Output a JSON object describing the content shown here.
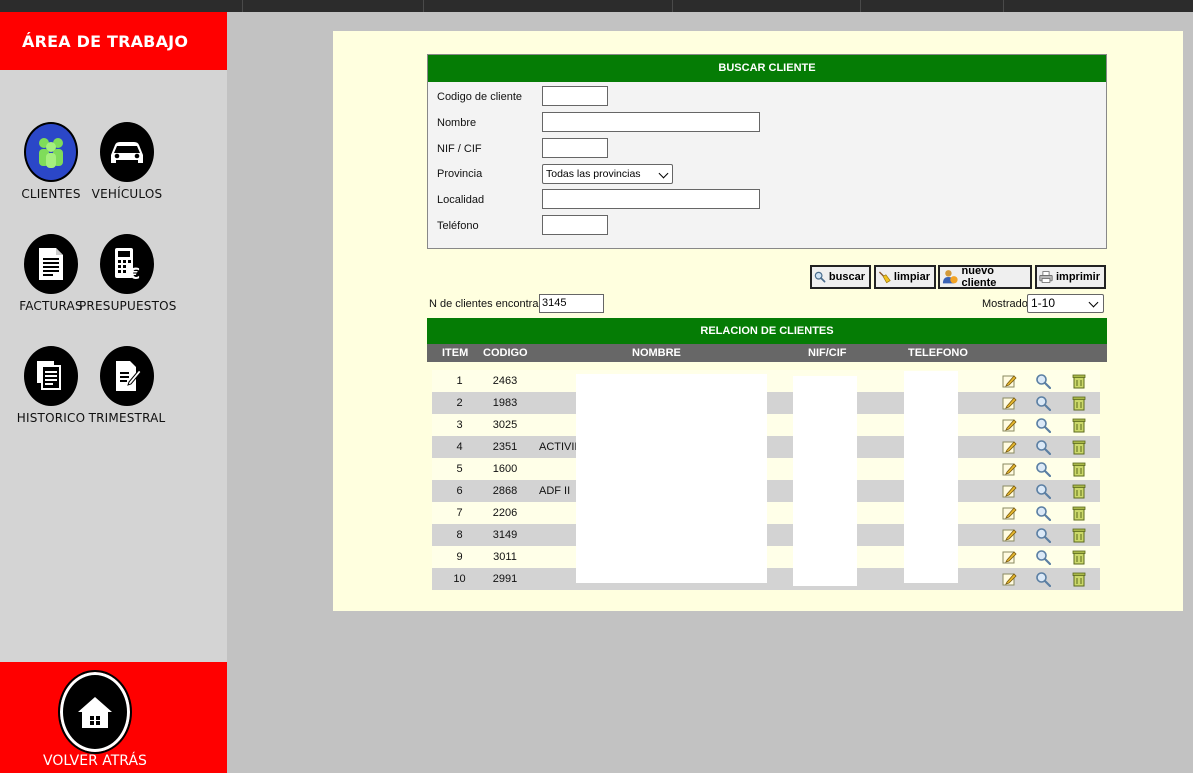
{
  "sidebar": {
    "title": "ÁREA DE TRABAJO",
    "items": [
      {
        "label": "CLIENTES",
        "icon": "clients-icon"
      },
      {
        "label": "VEHÍCULOS",
        "icon": "car-icon"
      },
      {
        "label": "FACTURAS",
        "icon": "invoice-icon"
      },
      {
        "label": "PRESUPUESTOS",
        "icon": "calculator-euro-icon"
      },
      {
        "label": "HISTORICO",
        "icon": "history-icon"
      },
      {
        "label": "TRIMESTRAL",
        "icon": "quarterly-report-icon"
      }
    ],
    "back_label": "VOLVER ATRÁS"
  },
  "search": {
    "title": "BUSCAR CLIENTE",
    "fields": {
      "codigo": {
        "label": "Codigo de cliente",
        "value": ""
      },
      "nombre": {
        "label": "Nombre",
        "value": ""
      },
      "nif": {
        "label": "NIF / CIF",
        "value": ""
      },
      "provincia": {
        "label": "Provincia",
        "value": "Todas las provincias"
      },
      "localidad": {
        "label": "Localidad",
        "value": ""
      },
      "telefono": {
        "label": "Teléfono",
        "value": ""
      }
    }
  },
  "actions": {
    "buscar": "buscar",
    "limpiar": "limpiar",
    "nuevo": "nuevo cliente",
    "imprimir": "imprimir"
  },
  "results": {
    "found_label": "N de clientes encontrados",
    "found_value": "3145",
    "shown_label": "Mostrados",
    "shown_value": "1-10",
    "title": "RELACION DE CLIENTES",
    "columns": [
      "ITEM",
      "CODIGO",
      "NOMBRE",
      "NIF/CIF",
      "TELEFONO"
    ],
    "rows": [
      {
        "item": "1",
        "codigo": "2463",
        "nombre": ""
      },
      {
        "item": "2",
        "codigo": "1983",
        "nombre": ""
      },
      {
        "item": "3",
        "codigo": "3025",
        "nombre": ""
      },
      {
        "item": "4",
        "codigo": "2351",
        "nombre": "ACTIVID"
      },
      {
        "item": "5",
        "codigo": "1600",
        "nombre": ""
      },
      {
        "item": "6",
        "codigo": "2868",
        "nombre": "ADF II"
      },
      {
        "item": "7",
        "codigo": "2206",
        "nombre": ""
      },
      {
        "item": "8",
        "codigo": "3149",
        "nombre": ""
      },
      {
        "item": "9",
        "codigo": "3011",
        "nombre": ""
      },
      {
        "item": "10",
        "codigo": "2991",
        "nombre": ""
      }
    ]
  },
  "colors": {
    "accent_red": "#ff0000",
    "header_green": "#057c05",
    "panel_bg": "#ffffdf",
    "active_blue": "#2b47c8"
  }
}
